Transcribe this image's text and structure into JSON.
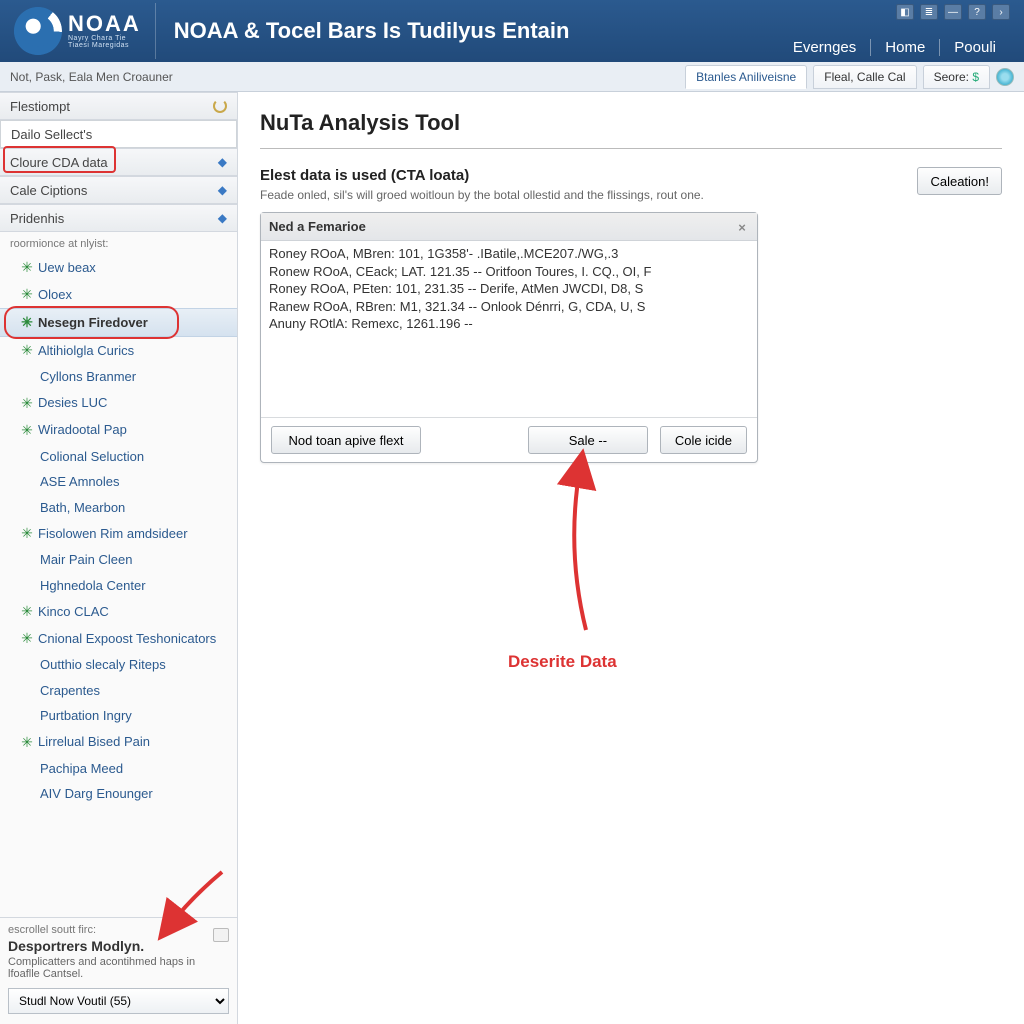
{
  "header": {
    "brand": "NOAA",
    "brand_sub1": "Nayry Chara Tie",
    "brand_sub2": "Tiaesi Maregidas",
    "title": "NOAA & Tocel Bars Is Tudilyus Entain",
    "nav": [
      "Evernges",
      "Home",
      "Poouli"
    ]
  },
  "secondbar": {
    "breadcrumb": "Not, Pask, Eala Men Croauner",
    "tabs": [
      "Btanles Aniliveisne",
      "Fleal, Calle Cal",
      "Seore:"
    ]
  },
  "sidebar": {
    "sections": [
      {
        "label": "Flestiompt"
      },
      {
        "label": "Dailo Sellect's"
      },
      {
        "label": "Cloure CDA data"
      },
      {
        "label": "Cale Ciptions"
      },
      {
        "label": "Pridenhis"
      }
    ],
    "minor": "roormionce at nlyist:",
    "tree": [
      {
        "text": "Uew beax",
        "bullet": true
      },
      {
        "text": "Oloex",
        "bullet": true
      },
      {
        "text": "Nesegn Firedover",
        "bullet": true,
        "selected": true
      },
      {
        "text": "Altihiolgla Curics",
        "bullet": true
      },
      {
        "text": "Cyllons Branmer",
        "bullet": false
      },
      {
        "text": "Desies LUC",
        "bullet": true
      },
      {
        "text": "Wiradootal Pap",
        "bullet": true
      },
      {
        "text": "Colional Seluction",
        "bullet": false
      },
      {
        "text": "ASE Amnoles",
        "bullet": false
      },
      {
        "text": "Bath, Mearbon",
        "bullet": false
      },
      {
        "text": "Fisolowen Rim amdsideer",
        "bullet": true
      },
      {
        "text": "Mair Pain Cleen",
        "bullet": false
      },
      {
        "text": "Hghnedola Center",
        "bullet": false
      },
      {
        "text": "Kinco CLAC",
        "bullet": true
      },
      {
        "text": "Cnional Expoost Teshonicators",
        "bullet": true,
        "multiline": true
      },
      {
        "text": "Outthio slecaly Riteps",
        "bullet": false
      },
      {
        "text": "Crapentes",
        "bullet": false
      },
      {
        "text": "Purtbation Ingry",
        "bullet": false
      },
      {
        "text": "Lirrelual Bised Pain",
        "bullet": true
      },
      {
        "text": "Pachipa Meed",
        "bullet": false
      },
      {
        "text": "AIV Darg Enounger",
        "bullet": false
      }
    ],
    "bottom": {
      "hint": "escrollel soutt firc:",
      "title": "Desportrers Modlyn.",
      "desc": "Complicatters and acontihmed haps in lfoaflle Cantsel.",
      "select": "Studl Now Voutil (55)"
    }
  },
  "main": {
    "title": "NuTa Analysis Tool",
    "section_title": "Elest data is used (CTA loata)",
    "section_desc": "Feade onled, sil's will groed woitloun by the botal ollestid and the flissings, rout one.",
    "calc_btn": "Caleation!",
    "dialog": {
      "title": "Ned a Femarioe",
      "rows": [
        "Roney  ROoA, MBren: 101, 1G358'- .IBatile,.MCE207./WG,.3",
        "Ronew  ROoA, CEack; LAT. 121.35 -- Oritfoon Toures, I. CQ., OI, F",
        "Roney  ROoA, PEten: 101, 231.35 -- Derife, AtMen  JWCDI, D8, S",
        "Ranew  ROoA, RBren: M1, 321.34 -- Onlook Dénrri, G, CDA, U, S",
        "Anuny ROtlA: Remexc, 1261.196 --"
      ],
      "actions": [
        "Nod toan apive flext",
        "Sale --",
        "Cole icide"
      ]
    },
    "annotation_label": "Deserite Data"
  }
}
